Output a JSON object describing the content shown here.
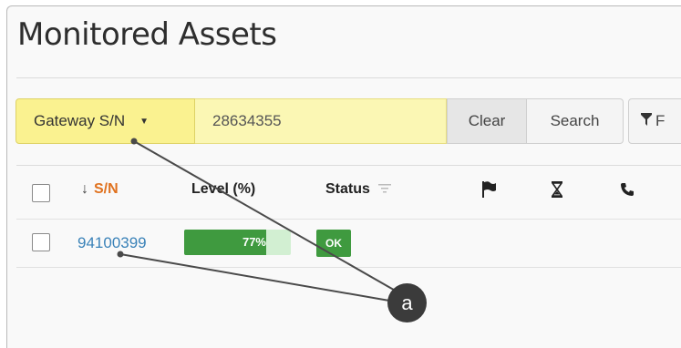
{
  "page": {
    "title": "Monitored Assets"
  },
  "search_bar": {
    "field_selector": "Gateway S/N",
    "search_value": "28634355",
    "clear_label": "Clear",
    "search_label": "Search",
    "filter_label": "F"
  },
  "table": {
    "headers": {
      "sn": "S/N",
      "sort_arrow": "↓",
      "level": "Level (%)",
      "status": "Status",
      "status_filter_icon": "filter-lines-icon",
      "flag_icon": "flag-icon",
      "hourglass_icon": "hourglass-icon",
      "phone_icon": "phone-icon"
    },
    "rows": [
      {
        "sn": "94100399",
        "level_text": "77%",
        "level_value": 0.77,
        "status": "OK"
      }
    ]
  },
  "annotation": {
    "callout_label": "a"
  },
  "colors": {
    "highlight_yellow": "#faf290",
    "link_blue": "#3a82b8",
    "sort_orange": "#e0721f",
    "status_green": "#3f9a3f"
  }
}
